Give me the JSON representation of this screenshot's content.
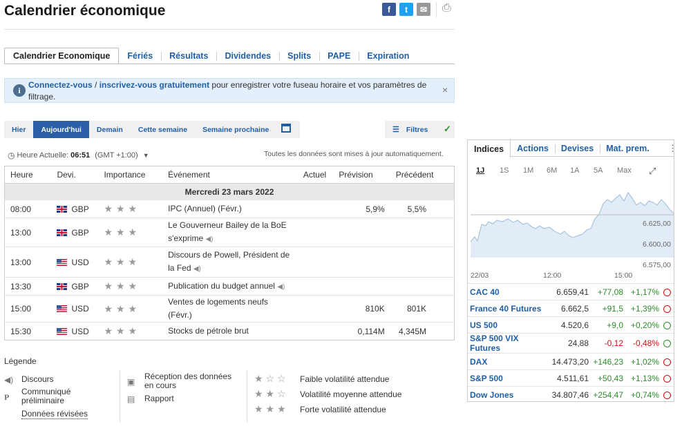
{
  "page": {
    "title": "Calendrier économique"
  },
  "share": {
    "facebook": "f",
    "twitter": "t",
    "email": "✉",
    "print": "⎙"
  },
  "tabs": [
    "Calendrier Economique",
    "Fériés",
    "Résultats",
    "Dividendes",
    "Splits",
    "PAPE",
    "Expiration"
  ],
  "login_bar": {
    "link1": "Connectez-vous",
    "sep": " / ",
    "link2": "inscrivez-vous gratuitement",
    "text": " pour enregistrer votre fuseau horaire et vos paramètres de filtrage.",
    "icon": "i",
    "close": "×"
  },
  "day_tabs": [
    "Hier",
    "Aujourd'hui",
    "Demain",
    "Cette semaine",
    "Semaine prochaine"
  ],
  "filters_label": "Filtres",
  "clock": {
    "label": "Heure Actuelle:",
    "time": "06:51",
    "tz": "(GMT +1:00)"
  },
  "auto_update": "Toutes les données sont mises à jour automatiquement.",
  "table": {
    "headers": [
      "Heure",
      "Devi.",
      "Importance",
      "Événement",
      "Actuel",
      "Prévision",
      "Précédent"
    ],
    "date": "Mercredi 23 mars 2022",
    "rows": [
      {
        "time": "08:00",
        "cur": "GBP",
        "flag": "gb",
        "event": "IPC (Annuel) (Févr.)",
        "speaker": false,
        "actual": "",
        "forecast": "5,9%",
        "previous": "5,5%"
      },
      {
        "time": "13:00",
        "cur": "GBP",
        "flag": "gb",
        "event": "Le Gouverneur Bailey de la BoE s'exprime",
        "speaker": true,
        "actual": "",
        "forecast": "",
        "previous": ""
      },
      {
        "time": "13:00",
        "cur": "USD",
        "flag": "us",
        "event": "Discours de Powell, Président de la Fed",
        "speaker": true,
        "actual": "",
        "forecast": "",
        "previous": ""
      },
      {
        "time": "13:30",
        "cur": "GBP",
        "flag": "gb",
        "event": "Publication du budget annuel",
        "speaker": true,
        "actual": "",
        "forecast": "",
        "previous": ""
      },
      {
        "time": "15:00",
        "cur": "USD",
        "flag": "us",
        "event": "Ventes de logements neufs (Févr.)",
        "speaker": false,
        "actual": "",
        "forecast": "810K",
        "previous": "801K"
      },
      {
        "time": "15:30",
        "cur": "USD",
        "flag": "us",
        "event": "Stocks de pétrole brut",
        "speaker": false,
        "actual": "",
        "forecast": "0,114M",
        "previous": "4,345M"
      }
    ]
  },
  "legend": {
    "title": "Légende",
    "discours": "Discours",
    "prelim": "Communiqué préliminaire",
    "revised": "Données révisées",
    "reception": "Réception des données en cours",
    "rapport": "Rapport",
    "low": "Faible volatilité attendue",
    "medium": "Volatilité moyenne attendue",
    "high": "Forte volatilité attendue"
  },
  "panel": {
    "tabs": [
      "Indices",
      "Actions",
      "Devises",
      "Mat. prem."
    ],
    "more": "⋮",
    "periods": [
      "1J",
      "1S",
      "1M",
      "6M",
      "1A",
      "5A",
      "Max"
    ],
    "expand": "⤢",
    "chart": {
      "x_labels": [
        "22/03",
        "12:00",
        "15:00"
      ],
      "y_labels": [
        "6.625,00",
        "6.600,00",
        "6.575,00"
      ]
    },
    "quotes": [
      {
        "name": "CAC 40",
        "last": "6.659,41",
        "chg": "+77,08",
        "pct": "+1,17%",
        "dir": "up",
        "status": "closed"
      },
      {
        "name": "France 40 Futures",
        "last": "6.662,5",
        "chg": "+91,5",
        "pct": "+1,39%",
        "dir": "up",
        "status": "closed"
      },
      {
        "name": "US 500",
        "last": "4.520,6",
        "chg": "+9,0",
        "pct": "+0,20%",
        "dir": "up",
        "status": "open"
      },
      {
        "name": "S&P 500 VIX Futures",
        "last": "24,88",
        "chg": "-0,12",
        "pct": "-0,48%",
        "dir": "down",
        "status": "open"
      },
      {
        "name": "DAX",
        "last": "14.473,20",
        "chg": "+146,23",
        "pct": "+1,02%",
        "dir": "up",
        "status": "closed"
      },
      {
        "name": "S&P 500",
        "last": "4.511,61",
        "chg": "+50,43",
        "pct": "+1,13%",
        "dir": "up",
        "status": "closed"
      },
      {
        "name": "Dow Jones",
        "last": "34.807,46",
        "chg": "+254,47",
        "pct": "+0,74%",
        "dir": "up",
        "status": "closed"
      }
    ]
  }
}
